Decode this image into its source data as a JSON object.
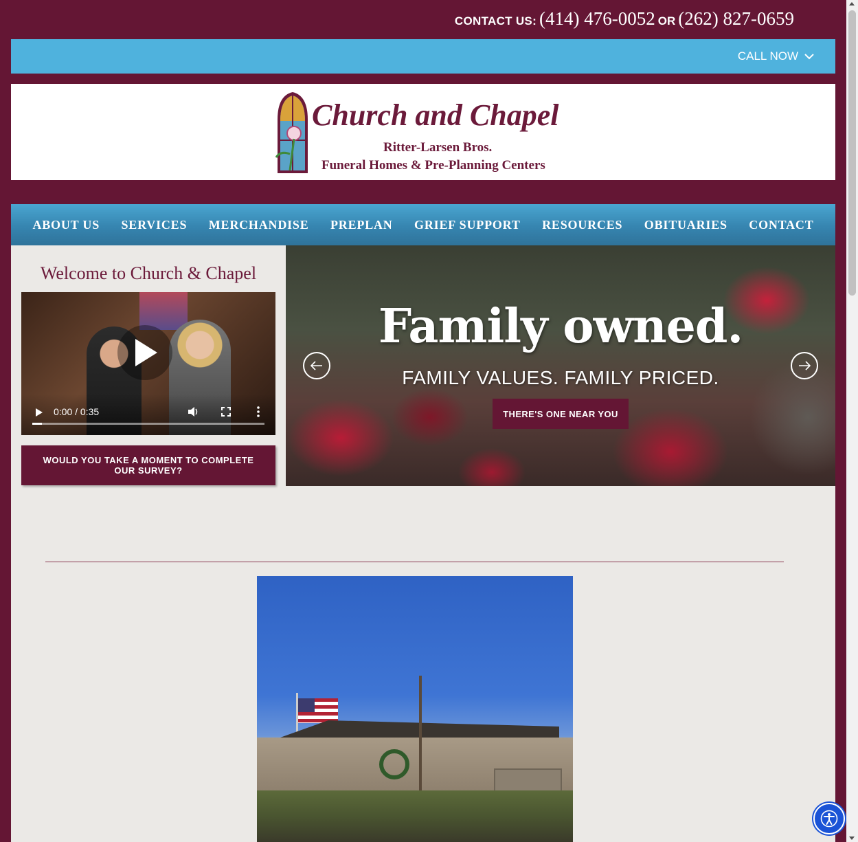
{
  "contact": {
    "label": "CONTACT US:",
    "phone1": "(414) 476-0052",
    "or": "OR",
    "phone2": "(262) 827-0659"
  },
  "callnow": {
    "label": "CALL NOW"
  },
  "logo": {
    "title": "Church and Chapel",
    "sub1": "Ritter-Larsen Bros.",
    "sub2": "Funeral Homes & Pre-Planning Centers"
  },
  "nav": {
    "items": [
      {
        "label": "ABOUT US"
      },
      {
        "label": "SERVICES"
      },
      {
        "label": "MERCHANDISE"
      },
      {
        "label": "PREPLAN"
      },
      {
        "label": "GRIEF SUPPORT"
      },
      {
        "label": "RESOURCES"
      },
      {
        "label": "OBITUARIES"
      },
      {
        "label": "CONTACT"
      }
    ]
  },
  "sidebar": {
    "welcome": "Welcome to Church & Chapel",
    "video_time": "0:00 / 0:35",
    "video_progress": 0.04,
    "survey_label": "WOULD YOU TAKE A MOMENT TO COMPLETE OUR SURVEY?"
  },
  "hero": {
    "title": "Family owned.",
    "subtitle": "FAMILY VALUES. FAMILY PRICED.",
    "button": "THERE'S ONE NEAR YOU"
  },
  "colors": {
    "brand": "#641634",
    "accent_blue": "#4fb2dd",
    "background": "#ebe9e6"
  },
  "icons": {
    "callnow": "chevron-down-icon",
    "prev": "arrow-left-icon",
    "next": "arrow-right-icon",
    "play": "play-icon",
    "a11y": "accessibility-icon"
  }
}
